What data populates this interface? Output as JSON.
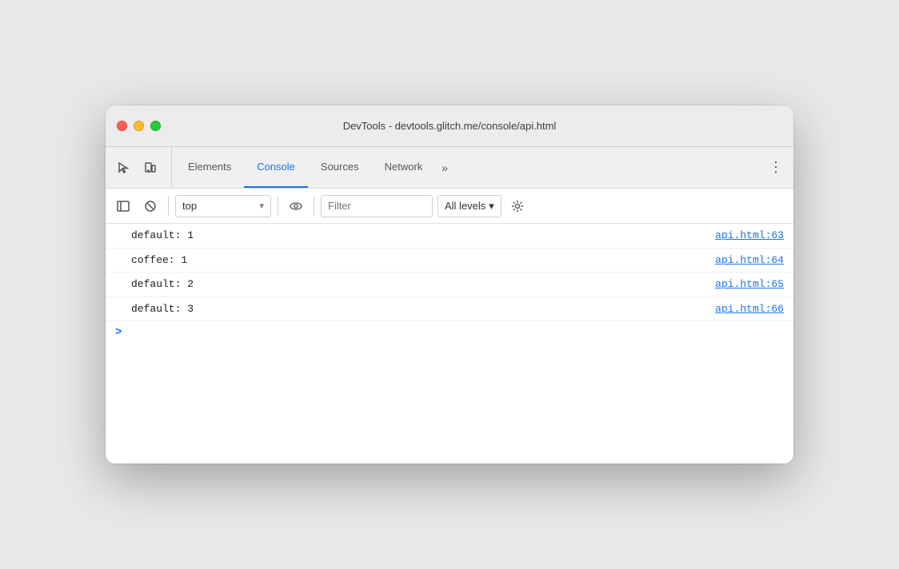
{
  "window": {
    "title": "DevTools - devtools.glitch.me/console/api.html",
    "traffic_lights": {
      "close_label": "close",
      "minimize_label": "minimize",
      "maximize_label": "maximize"
    }
  },
  "devtools": {
    "icon_select_label": "select-element",
    "icon_device_label": "toggle-device",
    "tabs": [
      {
        "id": "elements",
        "label": "Elements",
        "active": false
      },
      {
        "id": "console",
        "label": "Console",
        "active": true
      },
      {
        "id": "sources",
        "label": "Sources",
        "active": false
      },
      {
        "id": "network",
        "label": "Network",
        "active": false
      }
    ],
    "more_tabs_label": "»",
    "menu_label": "⋮"
  },
  "console": {
    "toolbar": {
      "clear_label": "clear-console",
      "block_label": "block",
      "context_value": "top",
      "context_placeholder": "top",
      "eye_label": "live-expressions",
      "filter_placeholder": "Filter",
      "levels_label": "All levels",
      "settings_label": "console-settings"
    },
    "rows": [
      {
        "text": "default: 1",
        "link": "api.html:63"
      },
      {
        "text": "coffee: 1",
        "link": "api.html:64"
      },
      {
        "text": "default: 2",
        "link": "api.html:65"
      },
      {
        "text": "default: 3",
        "link": "api.html:66"
      }
    ],
    "prompt_symbol": ">",
    "input_value": ""
  }
}
